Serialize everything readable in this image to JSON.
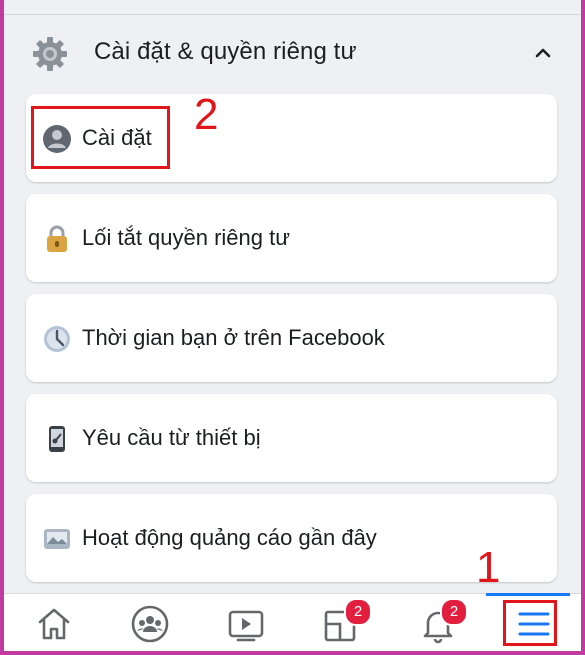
{
  "section": {
    "title": "Cài đặt & quyền riêng tư",
    "icon": "gear-icon",
    "toggle_icon": "chevron-up-icon"
  },
  "items": [
    {
      "label": "Cài đặt",
      "icon": "profile-icon"
    },
    {
      "label": "Lối tắt quyền riêng tư",
      "icon": "lock-icon"
    },
    {
      "label": "Thời gian bạn ở trên Facebook",
      "icon": "clock-icon"
    },
    {
      "label": "Yêu cầu từ thiết bị",
      "icon": "device-key-icon"
    },
    {
      "label": "Hoạt động quảng cáo gần đây",
      "icon": "ad-activity-icon"
    }
  ],
  "annotations": {
    "step1": "1",
    "step2": "2"
  },
  "nav": {
    "tabs": [
      "home-icon",
      "groups-icon",
      "watch-icon",
      "pages-icon",
      "notifications-icon",
      "menu-icon"
    ],
    "pages_badge": "2",
    "notifications_badge": "2"
  },
  "colors": {
    "accent": "#1877f2",
    "annotation": "#e0161b",
    "badge": "#e41e3f",
    "frame": "#c03aa0"
  }
}
